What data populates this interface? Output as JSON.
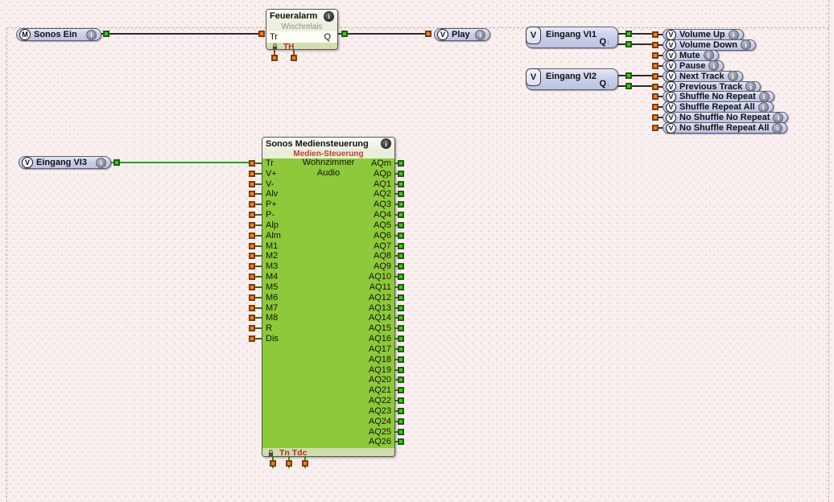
{
  "palette": {
    "background": "#f9efee",
    "pill_fill": "#cacfe9",
    "block_body_green": "#8ec93b",
    "connector_orange": "#f08126",
    "connector_green": "#47c226",
    "wire_black": "#2d2d2d",
    "wire_green": "#0ea30e",
    "param_text_red": "#b03226",
    "subtitle_red": "#c23b2e"
  },
  "blocks": {
    "sonos_ein": {
      "badge": "M",
      "label": "Sonos Ein"
    },
    "feueralarm": {
      "title": "Feueralarm",
      "type": "Wischrelais",
      "input_label": "Tr",
      "output_label": "Q",
      "param_label": "TH"
    },
    "play": {
      "badge": "V",
      "label": "Play"
    },
    "vi1": {
      "badge": "V",
      "label": "Eingang VI1",
      "q_label": "Q",
      "q_arrow": "↓"
    },
    "vi2": {
      "badge": "V",
      "label": "Eingang VI2",
      "q_label": "Q",
      "q_arrow": "↓"
    },
    "vi3": {
      "badge": "V",
      "label": "Eingang VI3"
    },
    "media": {
      "title": "Sonos Mediensteuerung",
      "subtitle": "Medien-Steuerung",
      "room": "Wohnzimmer",
      "category": "Audio",
      "param_label": "Tn Tdc",
      "inputs": [
        "Tr",
        "V+",
        "V-",
        "Alv",
        "P+",
        "P-",
        "Alp",
        "Alm",
        "M1",
        "M2",
        "M3",
        "M4",
        "M5",
        "M6",
        "M7",
        "M8",
        "R",
        "Dis"
      ],
      "outputs": [
        "AQm",
        "AQp",
        "AQ1",
        "AQ2",
        "AQ3",
        "AQ4",
        "AQ5",
        "AQ6",
        "AQ7",
        "AQ8",
        "AQ9",
        "AQ10",
        "AQ11",
        "AQ12",
        "AQ13",
        "AQ14",
        "AQ15",
        "AQ16",
        "AQ17",
        "AQ18",
        "AQ19",
        "AQ20",
        "AQ21",
        "AQ22",
        "AQ23",
        "AQ24",
        "AQ25",
        "AQ26"
      ]
    }
  },
  "commands": [
    {
      "badge": "V",
      "label": "Volume Up"
    },
    {
      "badge": "V",
      "label": "Volume Down"
    },
    {
      "badge": "V",
      "label": "Mute"
    },
    {
      "badge": "V",
      "label": "Pause"
    },
    {
      "badge": "V",
      "label": "Next Track"
    },
    {
      "badge": "V",
      "label": "Previous Track"
    },
    {
      "badge": "V",
      "label": "Shuffle No Repeat"
    },
    {
      "badge": "V",
      "label": "Shuffle Repeat All"
    },
    {
      "badge": "V",
      "label": "No Shuffle No Repeat"
    },
    {
      "badge": "V",
      "label": "No Shuffle Repeat All"
    }
  ]
}
